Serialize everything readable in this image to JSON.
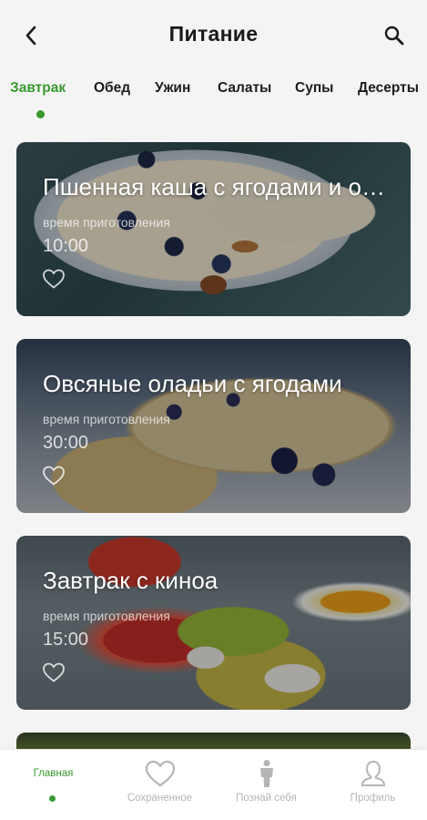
{
  "header": {
    "title": "Питание",
    "back_icon": "chevron-left-icon",
    "search_icon": "search-icon"
  },
  "tabs": [
    {
      "label": "Завтрак",
      "active": true
    },
    {
      "label": "Обед",
      "active": false
    },
    {
      "label": "Ужин",
      "active": false
    },
    {
      "label": "Салаты",
      "active": false
    },
    {
      "label": "Супы",
      "active": false
    },
    {
      "label": "Десерты",
      "active": false
    }
  ],
  "recipes": [
    {
      "name": "Пшенная каша с ягодами и орехами",
      "time_label": "время приготовления",
      "time": "10:00",
      "favorite": false
    },
    {
      "name": "Овсяные оладьи с ягодами",
      "time_label": "время приготовления",
      "time": "30:00",
      "favorite": false
    },
    {
      "name": "Завтрак с киноа",
      "time_label": "время приготовления",
      "time": "15:00",
      "favorite": false
    }
  ],
  "bottom_nav": [
    {
      "label": "Главная",
      "icon": "home-icon",
      "active": true
    },
    {
      "label": "Сохраненное",
      "icon": "heart-icon",
      "active": false
    },
    {
      "label": "Познай себя",
      "icon": "person-icon",
      "active": false
    },
    {
      "label": "Профиль",
      "icon": "profile-icon",
      "active": false
    }
  ],
  "colors": {
    "accent": "#3a9a2f",
    "inactive": "#b5b5b5"
  }
}
